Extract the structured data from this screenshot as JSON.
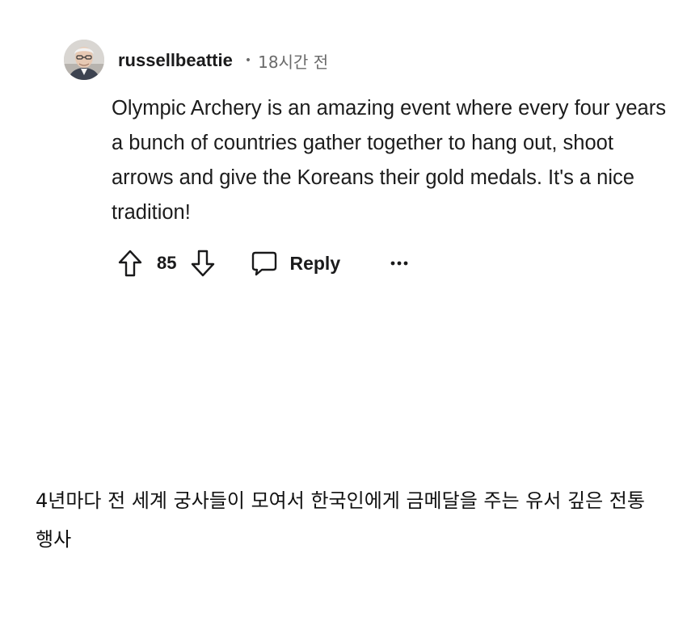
{
  "comment": {
    "author": {
      "username": "russellbeattie",
      "avatar_icon": "user-avatar-photo"
    },
    "separator": "•",
    "timestamp": "18시간 전",
    "body": "Olympic Archery is an amazing event where every four years a bunch of countries gather together to hang out, shoot arrows and give the Koreans their gold medals. It's a nice tradition!",
    "actions": {
      "upvote_icon": "arrow-up-icon",
      "vote_count": "85",
      "downvote_icon": "arrow-down-icon",
      "reply_icon": "speech-bubble-icon",
      "reply_label": "Reply",
      "more_icon": "ellipsis-icon"
    }
  },
  "caption": {
    "text": "4년마다 전 세계 궁사들이 모여서 한국인에게 금메달을 주는 유서 깊은 전통 행사"
  },
  "colors": {
    "text_primary": "#1a1a1b",
    "text_secondary": "#6a6a6a",
    "icon_stroke": "#1a1a1b",
    "background": "#ffffff"
  }
}
